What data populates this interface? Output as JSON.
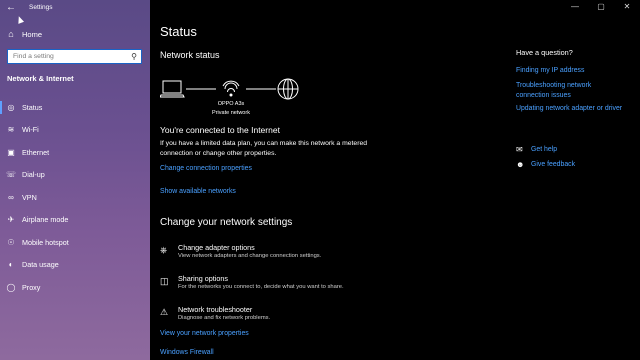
{
  "window": {
    "title": "Settings",
    "controls": [
      "—",
      "▢",
      "✕"
    ]
  },
  "sidebar": {
    "home_label": "Home",
    "search_placeholder": "Find a setting",
    "section_title": "Network & Internet",
    "items": [
      {
        "label": "Status",
        "icon": "home-network-icon",
        "active": true
      },
      {
        "label": "Wi-Fi",
        "icon": "wifi-icon"
      },
      {
        "label": "Ethernet",
        "icon": "ethernet-icon"
      },
      {
        "label": "Dial-up",
        "icon": "phone-icon"
      },
      {
        "label": "VPN",
        "icon": "vpn-icon"
      },
      {
        "label": "Airplane mode",
        "icon": "airplane-icon"
      },
      {
        "label": "Mobile hotspot",
        "icon": "hotspot-icon"
      },
      {
        "label": "Data usage",
        "icon": "data-usage-icon"
      },
      {
        "label": "Proxy",
        "icon": "globe-icon"
      }
    ]
  },
  "main": {
    "title": "Status",
    "network_status": "Network status",
    "device_name": "OPPO A3s",
    "network_kind": "Private network",
    "connected": "You're connected to the Internet",
    "description": "If you have a limited data plan, you can make this network a metered connection or change other properties.",
    "link_change_props": "Change connection properties",
    "link_show_networks": "Show available networks",
    "change_title": "Change your network settings",
    "options": [
      {
        "title": "Change adapter options",
        "desc": "View network adapters and change connection settings."
      },
      {
        "title": "Sharing options",
        "desc": "For the networks you connect to, decide what you want to share."
      },
      {
        "title": "Network troubleshooter",
        "desc": "Diagnose and fix network problems."
      }
    ],
    "link_view_props": "View your network properties",
    "link_firewall": "Windows Firewall"
  },
  "right": {
    "question": "Have a question?",
    "links": [
      "Finding my IP address",
      "Troubleshooting network connection issues",
      "Updating network adapter or driver"
    ],
    "get_help": "Get help",
    "give_feedback": "Give feedback"
  },
  "colors": {
    "accent": "#4aa0ff",
    "sidebar": "#6a5090",
    "background": "#000000"
  }
}
